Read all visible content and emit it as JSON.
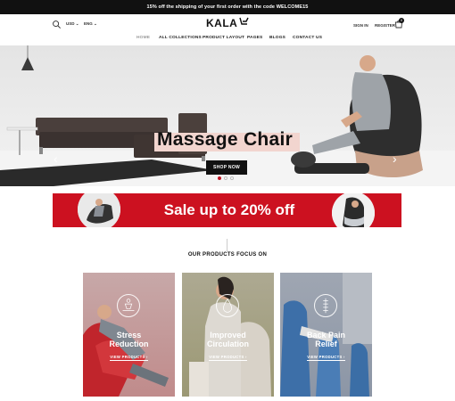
{
  "promo_bar": {
    "text": "15% off the shipping of your first order with the code WELCOME15"
  },
  "header": {
    "currency": "USD",
    "language": "ENG",
    "logo_text": "KALA",
    "sign_in": "SIGN IN",
    "register": "REGISTER",
    "cart_count": "0"
  },
  "nav": {
    "items": [
      "HOME",
      "ALL COLLECTIONS",
      "PRODUCT LAYOUT",
      "PAGES",
      "BLOGS",
      "CONTACT US"
    ],
    "active_index": 0
  },
  "hero": {
    "title": "Massage Chair",
    "button_label": "SHOP NOW",
    "slides": 3,
    "active_slide": 0
  },
  "sale_banner": {
    "text": "Sale up to 20% off"
  },
  "focus_section": {
    "title": "OUR PRODUCTS FOCUS ON",
    "cards": [
      {
        "title_line1": "Stress",
        "title_line2": "Reduction",
        "link": "VIEW PRODUCTS",
        "icon": "meditation-icon"
      },
      {
        "title_line1": "Improved",
        "title_line2": "Circulation",
        "link": "VIEW PRODUCTS",
        "icon": "droplet-icon"
      },
      {
        "title_line1": "Back Pain",
        "title_line2": "Relief",
        "link": "VIEW PRODUCTS",
        "icon": "spine-icon"
      }
    ]
  },
  "colors": {
    "accent_red": "#cc1120",
    "dark": "#111111",
    "title_highlight": "#f2d5cf"
  }
}
